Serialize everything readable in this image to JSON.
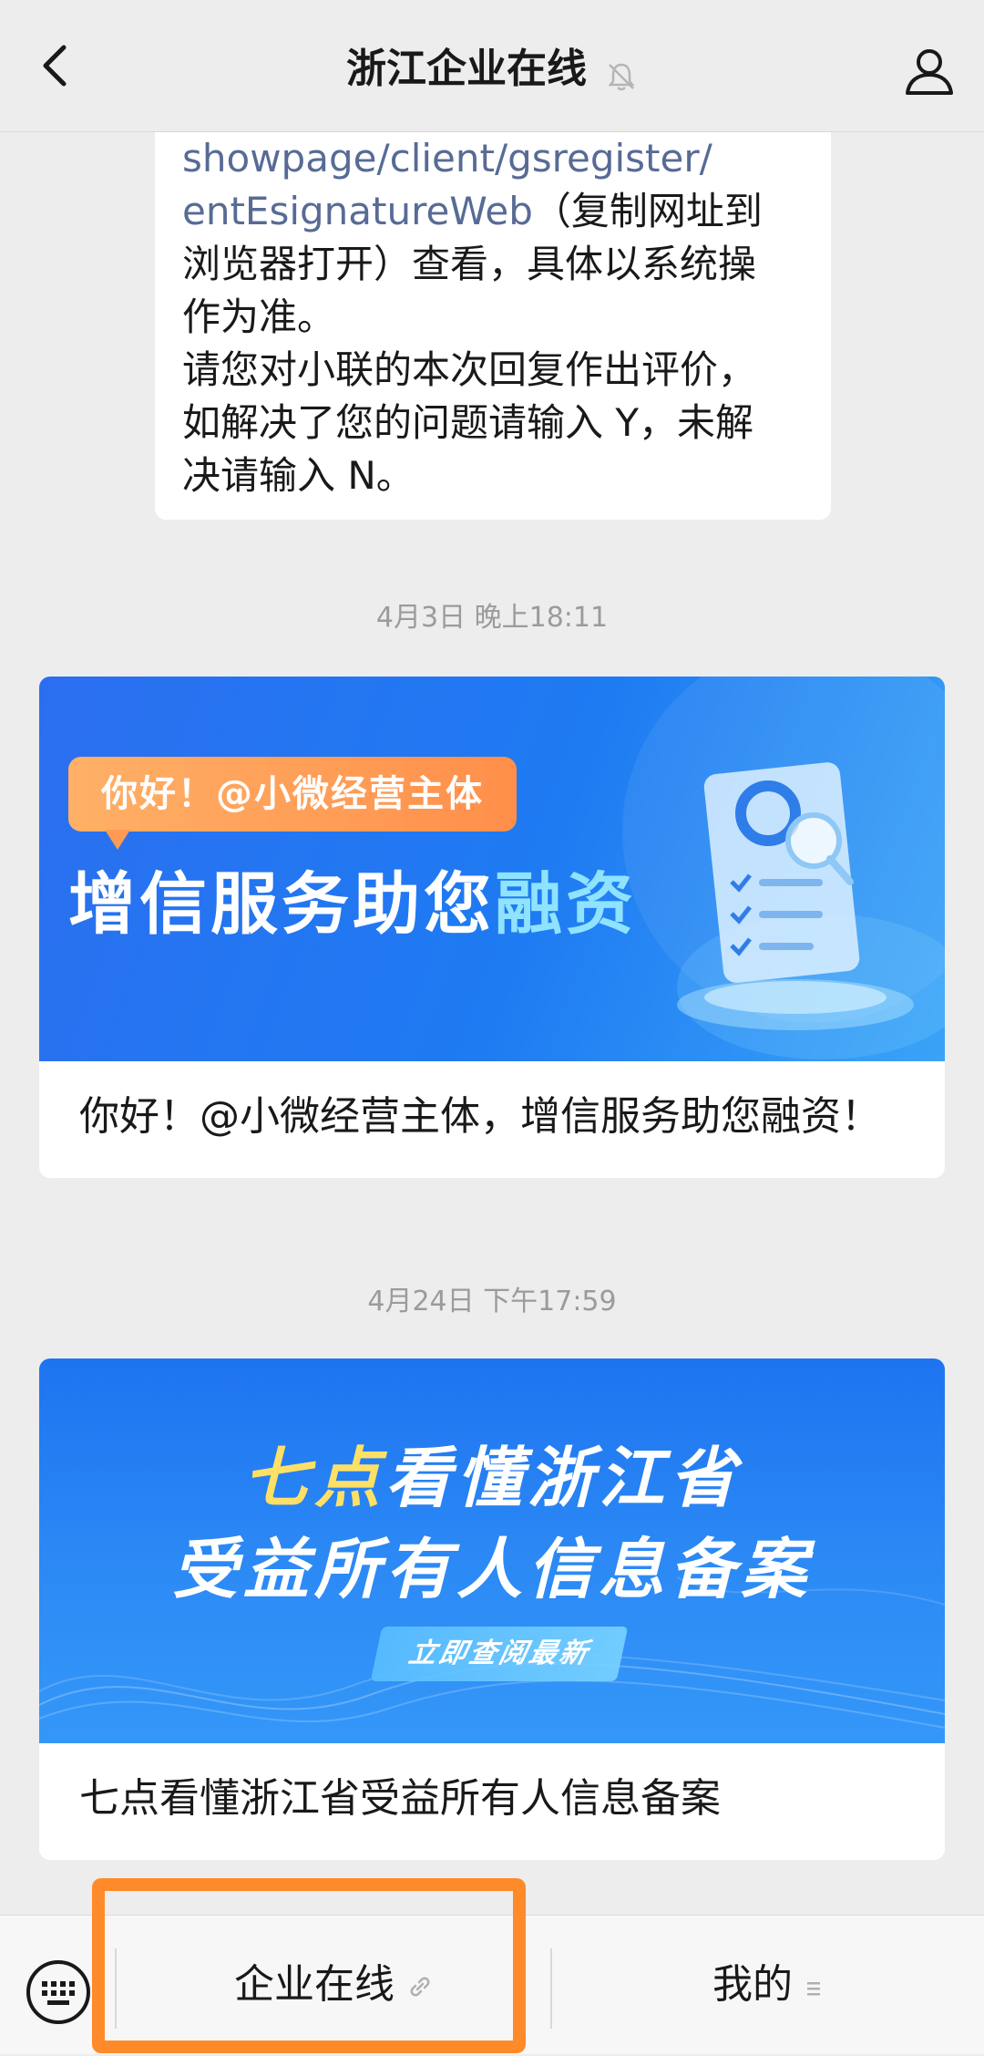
{
  "header": {
    "title": "浙江企业在线",
    "back_icon": "chevron-left-icon",
    "mute_icon": "bell-muted-icon",
    "profile_icon": "person-icon"
  },
  "message": {
    "link_line1": "showpage/client/gsregister/",
    "link_line2": "entEsignatureWeb",
    "line2_rest": "（复制网址到",
    "line3": "浏览器打开）查看，具体以系统操",
    "line4": "作为准。",
    "line5": "请您对小联的本次回复作出评价，",
    "line6": "如解决了您的问题请输入 Y，未解",
    "line7": "决请输入 N。"
  },
  "timestamps": [
    "4月3日 晚上18:11",
    "4月24日 下午17:59"
  ],
  "cards": [
    {
      "banner_tag": "你好！@小微经营主体",
      "banner_head_main": "增信服务助您",
      "banner_head_accent": "融资",
      "caption": "你好！@小微经营主体，增信服务助您融资！"
    },
    {
      "banner_line1_accent": "七点",
      "banner_line1_rest": "看懂浙江省",
      "banner_line2": "受益所有人信息备案",
      "banner_pill": "立即查阅最新",
      "caption": "七点看懂浙江省受益所有人信息备案"
    }
  ],
  "bottom_bar": {
    "keyboard_icon": "keyboard-icon",
    "menu1_label": "企业在线",
    "menu1_icon": "link-icon",
    "menu2_label": "我的",
    "menu2_icon": "menu-lines-icon"
  },
  "colors": {
    "accent_highlight": "#ff8a2a",
    "link": "#576b95",
    "background": "#ededed"
  }
}
